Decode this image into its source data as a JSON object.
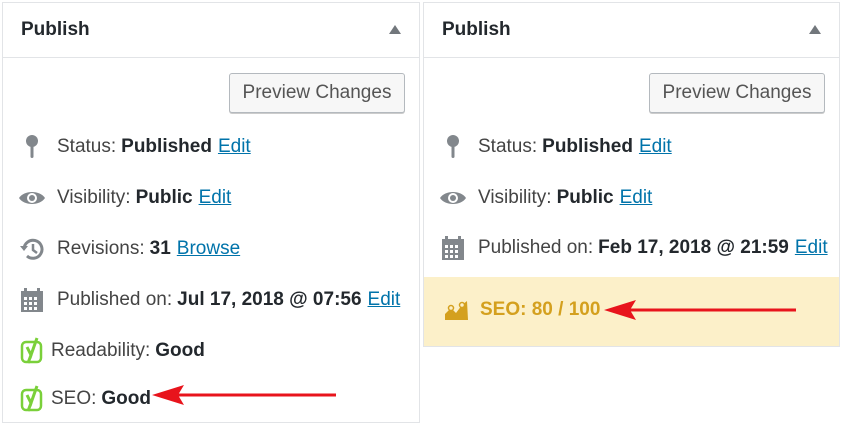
{
  "left_panel": {
    "title": "Publish",
    "preview_label": "Preview Changes",
    "status": {
      "label": "Status:",
      "value": "Published",
      "link": "Edit"
    },
    "visibility": {
      "label": "Visibility:",
      "value": "Public",
      "link": "Edit"
    },
    "revisions": {
      "label": "Revisions:",
      "value": "31",
      "link": "Browse"
    },
    "published_on": {
      "label": "Published on:",
      "value": "Jul 17, 2018 @ 07:56",
      "link": "Edit"
    },
    "readability": {
      "label": "Readability:",
      "value": "Good"
    },
    "seo": {
      "label": "SEO:",
      "value": "Good"
    }
  },
  "right_panel": {
    "title": "Publish",
    "preview_label": "Preview Changes",
    "status": {
      "label": "Status:",
      "value": "Published",
      "link": "Edit"
    },
    "visibility": {
      "label": "Visibility:",
      "value": "Public",
      "link": "Edit"
    },
    "published_on": {
      "label": "Published on:",
      "value": "Feb 17, 2018 @ 21:59",
      "link": "Edit"
    },
    "seo_score": "SEO: 80 / 100"
  },
  "colors": {
    "link": "#0073aa",
    "yoast_green": "#7ad03a",
    "seo_score_text": "#d4a01e",
    "seo_score_bg": "#fcf0c9",
    "arrow": "#e8141c"
  },
  "icons": [
    "pin-icon",
    "eye-icon",
    "history-icon",
    "calendar-icon",
    "yoast-icon",
    "seo-chart-icon",
    "collapse-arrow-icon"
  ]
}
